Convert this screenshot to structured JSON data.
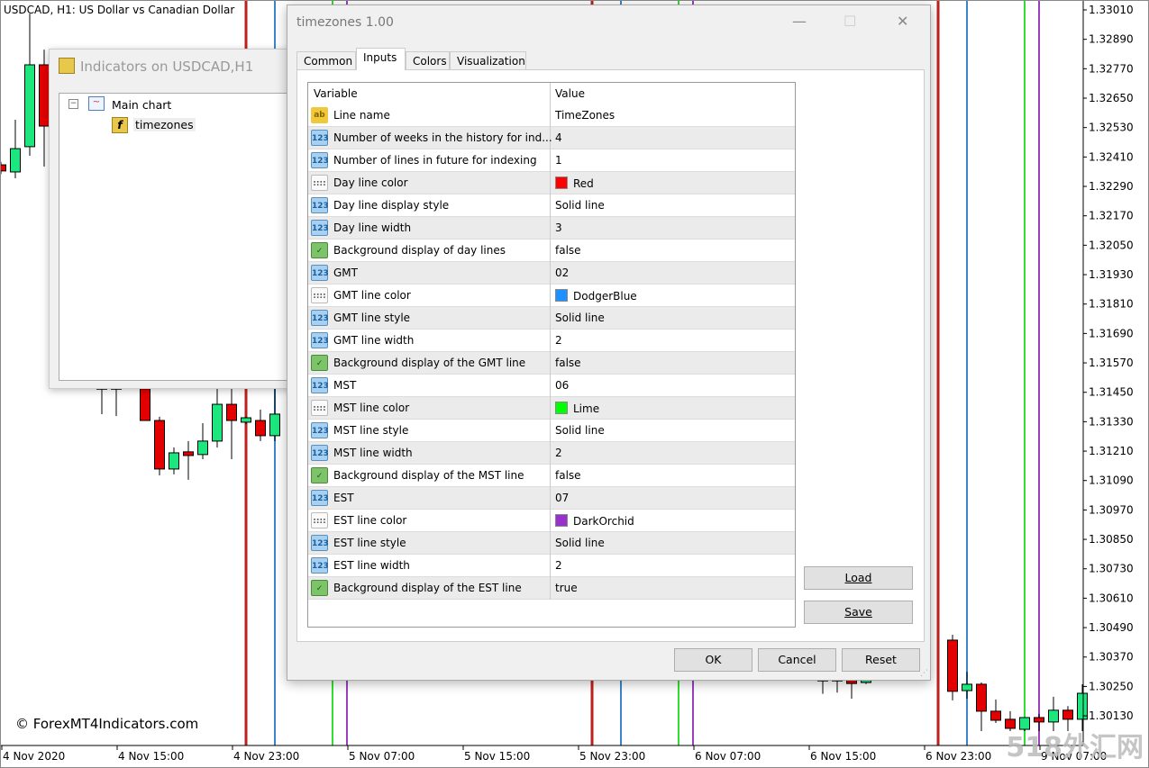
{
  "chart": {
    "symbol_label": "USDCAD, H1:  US Dollar vs Canadian Dollar",
    "copyright": "© ForexMT4Indicators.com",
    "watermark": "518外汇网",
    "price_labels": [
      "1.33010",
      "1.32890",
      "1.32770",
      "1.32650",
      "1.32530",
      "1.32410",
      "1.32290",
      "1.32170",
      "1.32050",
      "1.31930",
      "1.31810",
      "1.31690",
      "1.31570",
      "1.31450",
      "1.31330",
      "1.31210",
      "1.31090",
      "1.30970",
      "1.30850",
      "1.30730",
      "1.30610",
      "1.30490",
      "1.30370",
      "1.30250",
      "1.30130"
    ],
    "time_labels": [
      "4 Nov 2020",
      "4 Nov 15:00",
      "4 Nov 23:00",
      "5 Nov 07:00",
      "5 Nov 15:00",
      "5 Nov 23:00",
      "6 Nov 07:00",
      "6 Nov 15:00",
      "6 Nov 23:00",
      "9 Nov 07:00"
    ],
    "bull_color": "#1de67f",
    "bear_color": "#e20000",
    "vlines": [
      {
        "bar": 17,
        "color": "#c0201a"
      },
      {
        "bar": 19,
        "color": "#3a86c8"
      },
      {
        "bar": 23,
        "color": "#33dd33"
      },
      {
        "bar": 24,
        "color": "#9a3fc0"
      },
      {
        "bar": 41,
        "color": "#c0201a"
      },
      {
        "bar": 43,
        "color": "#3a86c8"
      },
      {
        "bar": 47,
        "color": "#33dd33"
      },
      {
        "bar": 48,
        "color": "#9a3fc0"
      },
      {
        "bar": 65,
        "color": "#c0201a"
      },
      {
        "bar": 67,
        "color": "#3a86c8"
      },
      {
        "bar": 71,
        "color": "#33dd33"
      },
      {
        "bar": 72,
        "color": "#9a3fc0"
      }
    ],
    "candles": [
      {
        "bar": 0,
        "o": 1.32378,
        "h": 1.3239,
        "l": 1.3234,
        "c": 1.32353
      },
      {
        "bar": 1,
        "o": 1.32349,
        "h": 1.32562,
        "l": 1.32323,
        "c": 1.32444
      },
      {
        "bar": 2,
        "o": 1.32452,
        "h": 1.32995,
        "l": 1.32415,
        "c": 1.32786
      },
      {
        "bar": 3,
        "o": 1.32786,
        "h": 1.32848,
        "l": 1.32371,
        "c": 1.32536
      },
      {
        "bar": 7,
        "o": 1.3147,
        "h": 1.315,
        "l": 1.31361,
        "c": 1.3147
      },
      {
        "bar": 8,
        "o": 1.3147,
        "h": 1.315,
        "l": 1.31353,
        "c": 1.3147
      },
      {
        "bar": 10,
        "o": 1.31464,
        "h": 1.315,
        "l": 1.31335,
        "c": 1.31335
      },
      {
        "bar": 11,
        "o": 1.31335,
        "h": 1.3135,
        "l": 1.31111,
        "c": 1.31137
      },
      {
        "bar": 12,
        "o": 1.31137,
        "h": 1.31225,
        "l": 1.31115,
        "c": 1.31203
      },
      {
        "bar": 13,
        "o": 1.31207,
        "h": 1.31251,
        "l": 1.31093,
        "c": 1.31192
      },
      {
        "bar": 14,
        "o": 1.31196,
        "h": 1.31324,
        "l": 1.31177,
        "c": 1.31251
      },
      {
        "bar": 15,
        "o": 1.31251,
        "h": 1.315,
        "l": 1.31225,
        "c": 1.31401
      },
      {
        "bar": 16,
        "o": 1.31401,
        "h": 1.315,
        "l": 1.31177,
        "c": 1.31335
      },
      {
        "bar": 17,
        "o": 1.31328,
        "h": 1.3135,
        "l": 1.3132,
        "c": 1.31346
      },
      {
        "bar": 18,
        "o": 1.31335,
        "h": 1.31379,
        "l": 1.31251,
        "c": 1.31273
      },
      {
        "bar": 19,
        "o": 1.31273,
        "h": 1.315,
        "l": 1.31251,
        "c": 1.31361
      },
      {
        "bar": 57,
        "o": 1.3028,
        "h": 1.3029,
        "l": 1.3022,
        "c": 1.3028
      },
      {
        "bar": 58,
        "o": 1.3028,
        "h": 1.3029,
        "l": 1.30225,
        "c": 1.3028
      },
      {
        "bar": 59,
        "o": 1.30285,
        "h": 1.3029,
        "l": 1.302,
        "c": 1.30262
      },
      {
        "bar": 60,
        "o": 1.30266,
        "h": 1.3029,
        "l": 1.3026,
        "c": 1.3028
      },
      {
        "bar": 63,
        "o": 1.30373,
        "h": 1.30527,
        "l": 1.3036,
        "c": 1.30421
      },
      {
        "bar": 66,
        "o": 1.30439,
        "h": 1.30461,
        "l": 1.30193,
        "c": 1.3023
      },
      {
        "bar": 67,
        "o": 1.30233,
        "h": 1.3031,
        "l": 1.302,
        "c": 1.30259
      },
      {
        "bar": 68,
        "o": 1.30259,
        "h": 1.30266,
        "l": 1.30068,
        "c": 1.30149
      },
      {
        "bar": 69,
        "o": 1.30149,
        "h": 1.30197,
        "l": 1.30101,
        "c": 1.30112
      },
      {
        "bar": 70,
        "o": 1.30116,
        "h": 1.30149,
        "l": 1.30068,
        "c": 1.30079
      },
      {
        "bar": 71,
        "o": 1.30075,
        "h": 1.30123,
        "l": 1.30068,
        "c": 1.30123
      },
      {
        "bar": 72,
        "o": 1.30123,
        "h": 1.30138,
        "l": 1.30068,
        "c": 1.30105
      },
      {
        "bar": 73,
        "o": 1.30105,
        "h": 1.30208,
        "l": 1.30068,
        "c": 1.30153
      },
      {
        "bar": 74,
        "o": 1.30153,
        "h": 1.3017,
        "l": 1.30068,
        "c": 1.30116
      },
      {
        "bar": 75,
        "o": 1.30116,
        "h": 1.30259,
        "l": 1.30068,
        "c": 1.30222
      }
    ]
  },
  "indicators_window": {
    "title": "Indicators on USDCAD,H1",
    "tree": {
      "root": "Main chart",
      "child": "timezones"
    }
  },
  "dialog": {
    "title": "timezones 1.00",
    "tabs": [
      "Common",
      "Inputs",
      "Colors",
      "Visualization"
    ],
    "active_tab": "Inputs",
    "columns": {
      "variable": "Variable",
      "value": "Value"
    },
    "rows": [
      {
        "type": "str",
        "icon": "ab",
        "variable": "Line name",
        "value": "TimeZones"
      },
      {
        "type": "num",
        "icon": "123",
        "variable": "Number of weeks in the history for ind...",
        "value": "4"
      },
      {
        "type": "num",
        "icon": "123",
        "variable": "Number of lines in future for indexing",
        "value": "1"
      },
      {
        "type": "col",
        "icon": "::::",
        "variable": "Day line color",
        "value": "Red",
        "swatch": "#ff0000"
      },
      {
        "type": "num",
        "icon": "123",
        "variable": "Day line display style",
        "value": "Solid line"
      },
      {
        "type": "num",
        "icon": "123",
        "variable": "Day line width",
        "value": "3"
      },
      {
        "type": "bool",
        "icon": "✓",
        "variable": "Background display of day lines",
        "value": "false"
      },
      {
        "type": "num",
        "icon": "123",
        "variable": "GMT",
        "value": "02"
      },
      {
        "type": "col",
        "icon": "::::",
        "variable": "GMT line color",
        "value": "DodgerBlue",
        "swatch": "#1e90ff"
      },
      {
        "type": "num",
        "icon": "123",
        "variable": "GMT line style",
        "value": "Solid line"
      },
      {
        "type": "num",
        "icon": "123",
        "variable": "GMT line width",
        "value": "2"
      },
      {
        "type": "bool",
        "icon": "✓",
        "variable": "Background display of the GMT line",
        "value": "false"
      },
      {
        "type": "num",
        "icon": "123",
        "variable": "MST",
        "value": "06"
      },
      {
        "type": "col",
        "icon": "::::",
        "variable": "MST line color",
        "value": "Lime",
        "swatch": "#00ff00"
      },
      {
        "type": "num",
        "icon": "123",
        "variable": "MST line style",
        "value": "Solid line"
      },
      {
        "type": "num",
        "icon": "123",
        "variable": "MST line width",
        "value": "2"
      },
      {
        "type": "bool",
        "icon": "✓",
        "variable": "Background display of the MST line",
        "value": "false"
      },
      {
        "type": "num",
        "icon": "123",
        "variable": "EST",
        "value": "07"
      },
      {
        "type": "col",
        "icon": "::::",
        "variable": "EST line color",
        "value": "DarkOrchid",
        "swatch": "#9932cc"
      },
      {
        "type": "num",
        "icon": "123",
        "variable": "EST line style",
        "value": "Solid line"
      },
      {
        "type": "num",
        "icon": "123",
        "variable": "EST line width",
        "value": "2"
      },
      {
        "type": "bool",
        "icon": "✓",
        "variable": "Background display of the EST line",
        "value": "true"
      }
    ],
    "buttons": {
      "load": "Load",
      "save": "Save",
      "ok": "OK",
      "cancel": "Cancel",
      "reset": "Reset"
    }
  }
}
